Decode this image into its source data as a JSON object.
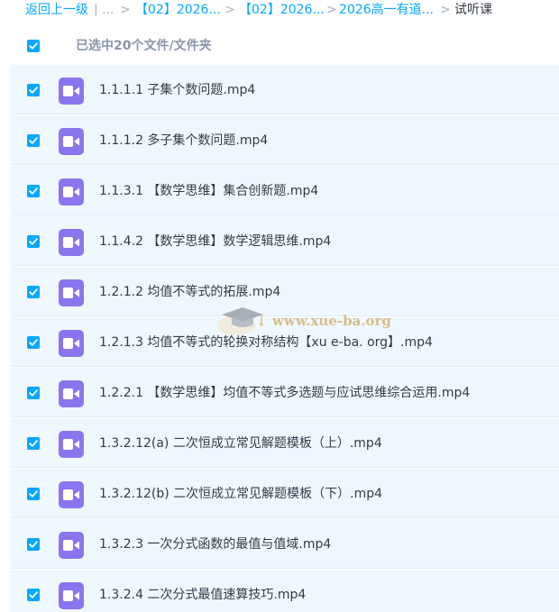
{
  "breadcrumb": {
    "back": "返回上一级",
    "divider": "|",
    "ellipsis": "...",
    "sep": ">",
    "items": [
      "【02】2026...",
      "【02】2026...",
      "2026高一有道...",
      "试听课"
    ]
  },
  "selection": {
    "label": "已选中20个文件/文件夹",
    "checked": true
  },
  "accent_color": "#06a7ff",
  "video_icon_color": "#8a75ee",
  "files": [
    {
      "name": "1.1.1.1 子集个数问题.mp4",
      "checked": true,
      "icon": "video-file-icon"
    },
    {
      "name": "1.1.1.2 多子集个数问题.mp4",
      "checked": true,
      "icon": "video-file-icon"
    },
    {
      "name": "1.1.3.1 【数学思维】集合创新题.mp4",
      "checked": true,
      "icon": "video-file-icon"
    },
    {
      "name": "1.1.4.2 【数学思维】数学逻辑思维.mp4",
      "checked": true,
      "icon": "video-file-icon"
    },
    {
      "name": "1.2.1.2 均值不等式的拓展.mp4",
      "checked": true,
      "icon": "video-file-icon"
    },
    {
      "name": "1.2.1.3 均值不等式的轮换对称结构【xu e-ba. org】.mp4",
      "checked": true,
      "icon": "video-file-icon"
    },
    {
      "name": "1.2.2.1 【数学思维】均值不等式多选题与应试思维综合运用.mp4",
      "checked": true,
      "icon": "video-file-icon"
    },
    {
      "name": "1.3.2.12(a) 二次恒成立常见解题模板（上）.mp4",
      "checked": true,
      "icon": "video-file-icon"
    },
    {
      "name": "1.3.2.12(b) 二次恒成立常见解题模板（下）.mp4",
      "checked": true,
      "icon": "video-file-icon"
    },
    {
      "name": "1.3.2.3 一次分式函数的最值与值域.mp4",
      "checked": true,
      "icon": "video-file-icon"
    },
    {
      "name": "1.3.2.4 二次分式最值速算技巧.mp4",
      "checked": true,
      "icon": "video-file-icon"
    }
  ],
  "watermark": {
    "text": "www.xue-ba.org",
    "icon": "graduation-cap-icon"
  }
}
